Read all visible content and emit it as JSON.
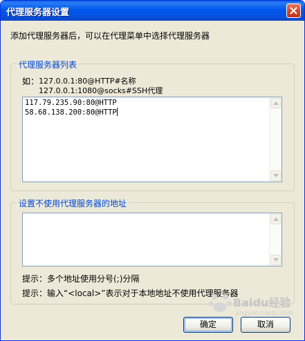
{
  "window": {
    "title": "代理服务器设置"
  },
  "subtitle": "添加代理服务器后，可以在代理菜单中选择代理服务器",
  "proxy_list_group": {
    "legend": "代理服务器列表",
    "example_label": "如：",
    "example_lines": [
      "127.0.0.1:80@HTTP#名称",
      "127.0.0.1:1080@socks#SSH代理"
    ],
    "textarea_lines": [
      "117.79.235.90:80@HTTP",
      "58.68.138.200:80@HTTP"
    ]
  },
  "bypass_group": {
    "legend": "设置不使用代理服务器的地址",
    "hint1": "提示：多个地址使用分号(;)分隔",
    "hint2": "提示：输入“<local>”表示对于本地地址不使用代理服务器"
  },
  "buttons": {
    "ok": "确定",
    "cancel": "取消"
  },
  "watermark": {
    "brand": "Baidu经验",
    "url": "jingyan.baidu.com"
  },
  "colors": {
    "titlebar": "#0058ee",
    "legend": "#0046d5",
    "dialog_bg": "#ece9d8"
  }
}
